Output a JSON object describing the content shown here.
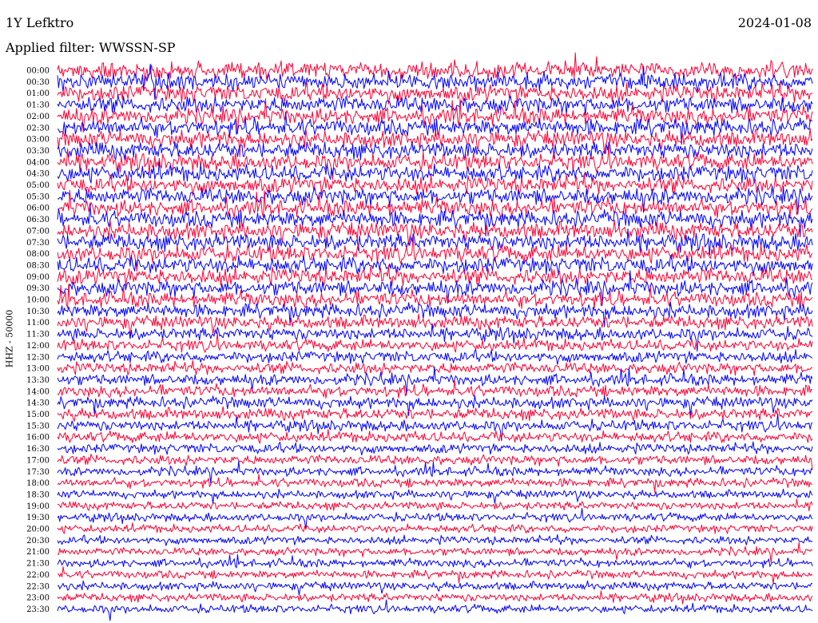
{
  "header": {
    "station": "1Y Lefktro",
    "date": "2024-01-08",
    "filter": "Applied filter: WWSSN-SP"
  },
  "chart_data": {
    "type": "line",
    "title": "1Y Lefktro",
    "ylabel": "HHZ - 50000",
    "row_interval_minutes": 30,
    "colors": [
      "#0000ff",
      "#ff0033"
    ],
    "rows": [
      {
        "label": "00:00",
        "amplitude": 1.0,
        "color": "#ff0033"
      },
      {
        "label": "00:30",
        "amplitude": 1.0,
        "color": "#0000ff"
      },
      {
        "label": "01:00",
        "amplitude": 1.0,
        "color": "#ff0033"
      },
      {
        "label": "01:30",
        "amplitude": 1.0,
        "color": "#0000ff"
      },
      {
        "label": "02:00",
        "amplitude": 1.0,
        "color": "#ff0033"
      },
      {
        "label": "02:30",
        "amplitude": 1.0,
        "color": "#0000ff"
      },
      {
        "label": "03:00",
        "amplitude": 1.0,
        "color": "#ff0033"
      },
      {
        "label": "03:30",
        "amplitude": 1.0,
        "color": "#0000ff"
      },
      {
        "label": "04:00",
        "amplitude": 1.0,
        "color": "#ff0033"
      },
      {
        "label": "04:30",
        "amplitude": 1.0,
        "color": "#0000ff"
      },
      {
        "label": "05:00",
        "amplitude": 1.0,
        "color": "#ff0033"
      },
      {
        "label": "05:30",
        "amplitude": 1.0,
        "color": "#0000ff"
      },
      {
        "label": "06:00",
        "amplitude": 1.0,
        "color": "#ff0033"
      },
      {
        "label": "06:30",
        "amplitude": 1.0,
        "color": "#0000ff"
      },
      {
        "label": "07:00",
        "amplitude": 1.0,
        "color": "#ff0033"
      },
      {
        "label": "07:30",
        "amplitude": 1.0,
        "color": "#0000ff"
      },
      {
        "label": "08:00",
        "amplitude": 1.0,
        "color": "#ff0033"
      },
      {
        "label": "08:30",
        "amplitude": 1.0,
        "color": "#0000ff"
      },
      {
        "label": "09:00",
        "amplitude": 1.0,
        "color": "#ff0033"
      },
      {
        "label": "09:30",
        "amplitude": 0.95,
        "color": "#0000ff"
      },
      {
        "label": "10:00",
        "amplitude": 0.9,
        "color": "#ff0033"
      },
      {
        "label": "10:30",
        "amplitude": 0.85,
        "color": "#0000ff"
      },
      {
        "label": "11:00",
        "amplitude": 0.8,
        "color": "#ff0033"
      },
      {
        "label": "11:30",
        "amplitude": 0.75,
        "color": "#0000ff"
      },
      {
        "label": "12:00",
        "amplitude": 0.7,
        "color": "#ff0033"
      },
      {
        "label": "12:30",
        "amplitude": 0.7,
        "color": "#0000ff"
      },
      {
        "label": "13:00",
        "amplitude": 0.7,
        "color": "#ff0033"
      },
      {
        "label": "13:30",
        "amplitude": 0.7,
        "color": "#0000ff"
      },
      {
        "label": "14:00",
        "amplitude": 0.7,
        "color": "#ff0033"
      },
      {
        "label": "14:30",
        "amplitude": 0.7,
        "color": "#0000ff"
      },
      {
        "label": "15:00",
        "amplitude": 0.7,
        "color": "#ff0033"
      },
      {
        "label": "15:30",
        "amplitude": 0.65,
        "color": "#0000ff"
      },
      {
        "label": "16:00",
        "amplitude": 0.65,
        "color": "#ff0033"
      },
      {
        "label": "16:30",
        "amplitude": 0.6,
        "color": "#0000ff"
      },
      {
        "label": "17:00",
        "amplitude": 0.6,
        "color": "#ff0033"
      },
      {
        "label": "17:30",
        "amplitude": 0.55,
        "color": "#0000ff"
      },
      {
        "label": "18:00",
        "amplitude": 0.55,
        "color": "#ff0033"
      },
      {
        "label": "18:30",
        "amplitude": 0.5,
        "color": "#0000ff"
      },
      {
        "label": "19:00",
        "amplitude": 0.5,
        "color": "#ff0033"
      },
      {
        "label": "19:30",
        "amplitude": 0.5,
        "color": "#0000ff"
      },
      {
        "label": "20:00",
        "amplitude": 0.5,
        "color": "#ff0033"
      },
      {
        "label": "20:30",
        "amplitude": 0.5,
        "color": "#0000ff"
      },
      {
        "label": "21:00",
        "amplitude": 0.5,
        "color": "#ff0033"
      },
      {
        "label": "21:30",
        "amplitude": 0.5,
        "color": "#0000ff"
      },
      {
        "label": "22:00",
        "amplitude": 0.5,
        "color": "#ff0033"
      },
      {
        "label": "22:30",
        "amplitude": 0.5,
        "color": "#0000ff"
      },
      {
        "label": "23:00",
        "amplitude": 0.5,
        "color": "#ff0033"
      },
      {
        "label": "23:30",
        "amplitude": 0.5,
        "color": "#0000ff"
      }
    ]
  }
}
